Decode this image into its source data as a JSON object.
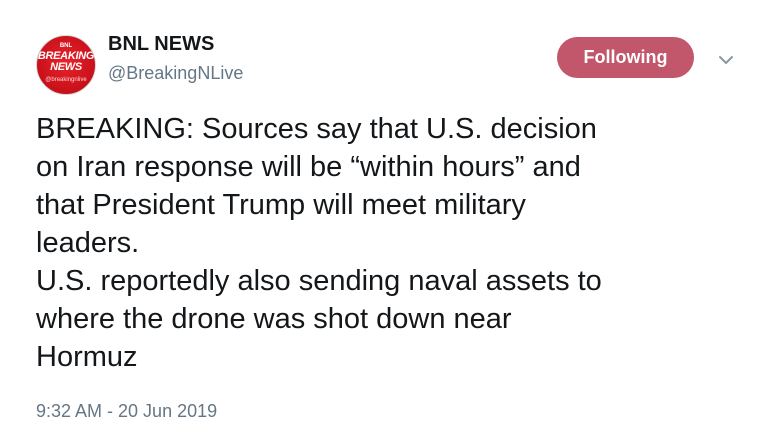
{
  "tweet": {
    "avatar": {
      "small_text": "BNL",
      "line1": "BREAKING",
      "line2": "NEWS",
      "handle_text": "@breakingnlive"
    },
    "name": "BNL NEWS",
    "handle": "@BreakingNLive",
    "follow_label": "Following",
    "text_lines": [
      "BREAKING: Sources say that U.S. decision",
      "on Iran response will be “within hours” and",
      "that President Trump will meet military",
      "leaders.",
      "U.S. reportedly also sending naval assets to",
      "where the drone was shot down near",
      "Hormuz"
    ],
    "timestamp": "9:32 AM - 20 Jun 2019",
    "caret_icon": "chevron-down-icon",
    "colors": {
      "follow_button": "#c2566a",
      "secondary_text": "#657786",
      "primary_text": "#14171a",
      "avatar_red": "#c8101a"
    }
  }
}
